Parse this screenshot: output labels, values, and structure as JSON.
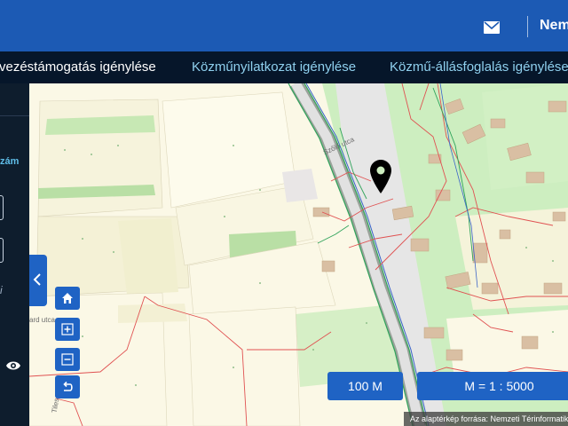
{
  "header": {
    "user_label": "Nem"
  },
  "tabs": [
    {
      "label": "rvezéstámogatás igénylése",
      "active": true
    },
    {
      "label": "Közműnyilatkozat igénylése",
      "active": false
    },
    {
      "label": "Közmű-állásfoglalás igénylése",
      "active": false
    }
  ],
  "sidebar": {
    "label": "zám",
    "italic": "i"
  },
  "map": {
    "scale_label": "100 M",
    "ratio_label": "M = 1 : 5000",
    "attribution": "Az alaptérkép forrása: Nemzeti Térinformatikai",
    "streets": [
      "Szőlő utca",
      "ard utca",
      "Tiles utca"
    ]
  },
  "icons": {
    "mail": "mail-icon",
    "eye": "eye-icon",
    "collapse": "chevron-left-icon",
    "home": "home-icon",
    "zoom_in": "plus-icon",
    "zoom_out": "minus-icon",
    "back": "undo-icon",
    "pin": "location-pin-icon"
  },
  "colors": {
    "header": "#1c5ab4",
    "tabbar": "#06162a",
    "button": "#1f63c4",
    "active_tab": "#ffffff",
    "inactive_tab": "#8fd0ee",
    "map_green": "#cdeec0",
    "utility_red": "#e05252"
  }
}
